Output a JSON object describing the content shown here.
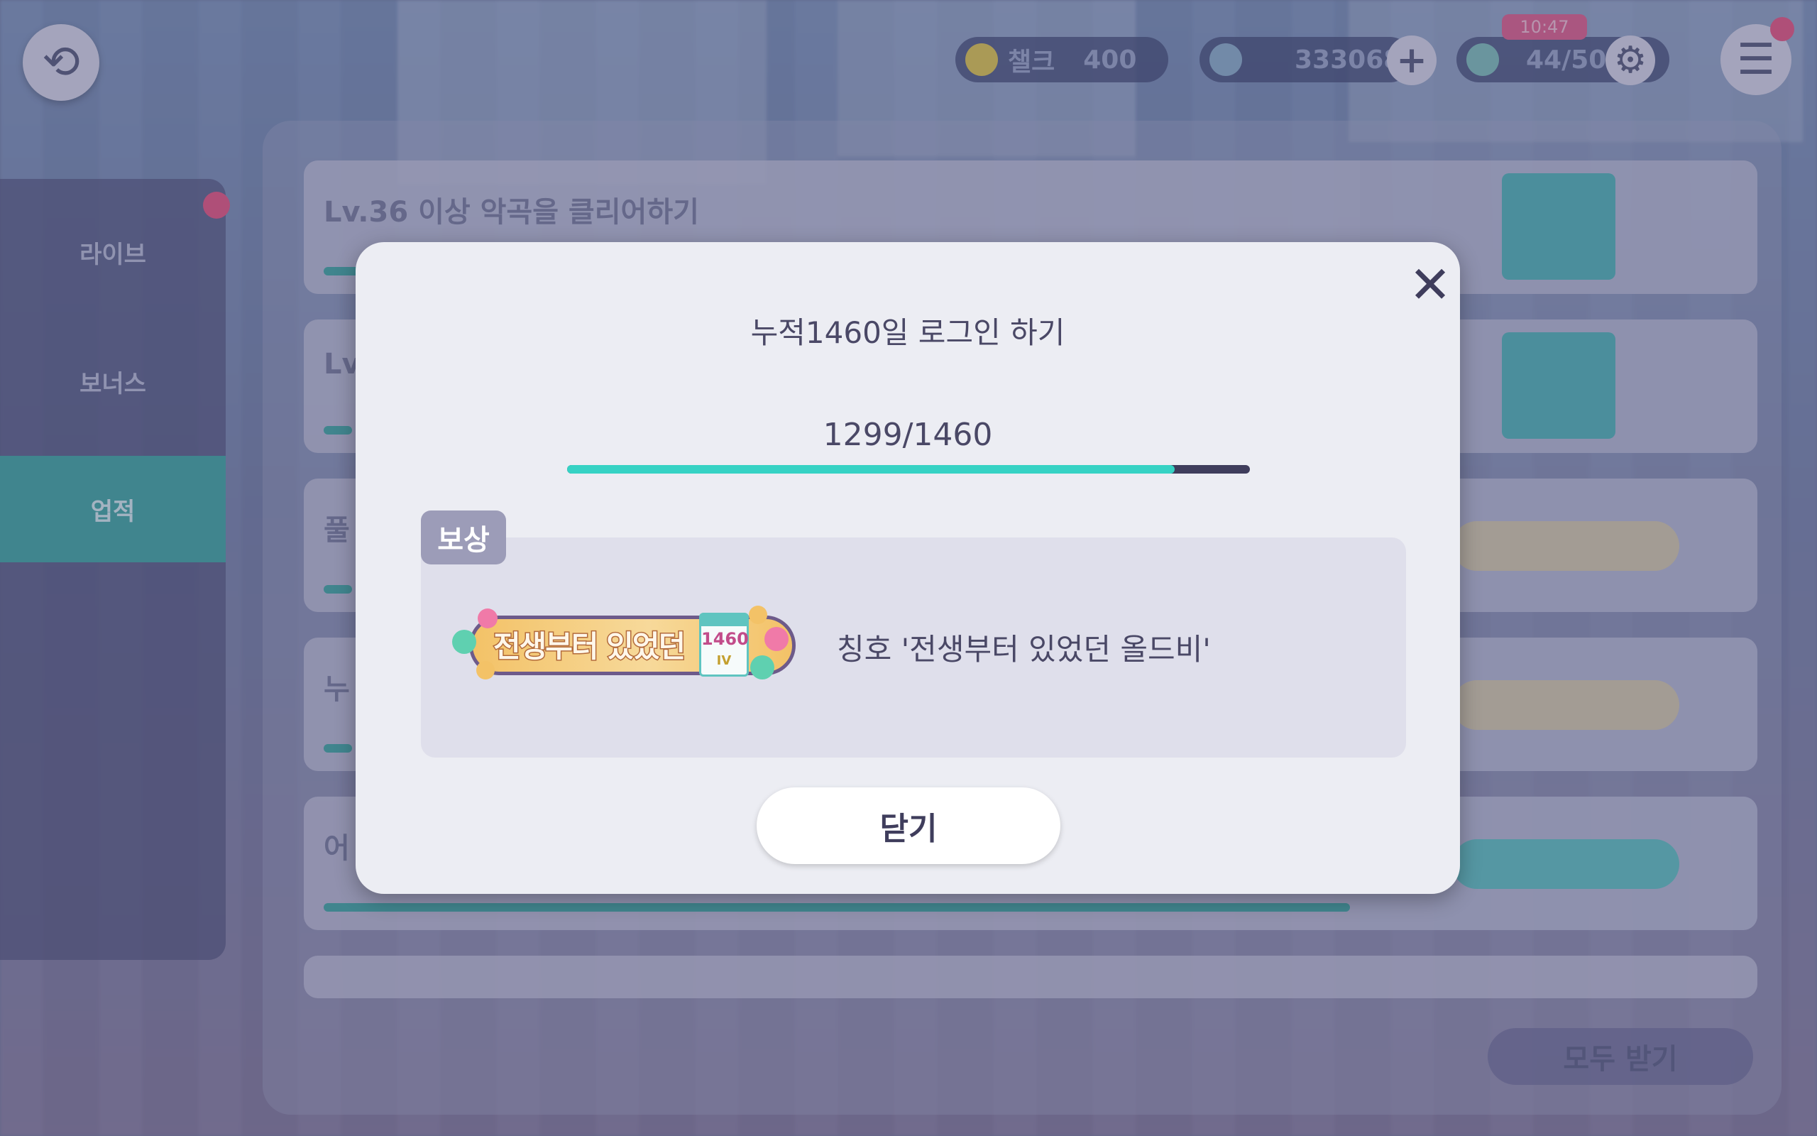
{
  "background": {
    "currency": {
      "stamina_label": "챌크",
      "stamina_value": "400",
      "crystal_value": "333068",
      "ticket_value": "44/50",
      "ticket_tag": "10:47"
    },
    "sidebar": {
      "items": [
        {
          "label": "라이브"
        },
        {
          "label": "보너스"
        },
        {
          "label": "업적"
        }
      ]
    },
    "missions": [
      {
        "text": "Lv.36 이상 악곡을 클리어하기",
        "progress": 0.03
      },
      {
        "text": "Lv",
        "progress": 0.02
      },
      {
        "text": "풀",
        "progress": 0.02
      },
      {
        "text": "누",
        "progress": 0.02
      },
      {
        "text": "어",
        "progress": 1.0
      }
    ],
    "claim_all_label": "모두 받기"
  },
  "modal": {
    "title": "누적1460일 로그인 하기",
    "progress_text": "1299/1460",
    "progress_current": 1299,
    "progress_total": 1460,
    "reward_tag": "보상",
    "badge": {
      "text": "전생부터 있었던",
      "calendar_number": "1460",
      "calendar_sub": "IV"
    },
    "reward_name": "칭호 '전생부터 있었던 올드비'",
    "close_button_label": "닫기",
    "colors": {
      "progress_fill": "#36d2c4",
      "progress_track": "#3f3d5c",
      "text": "#4a4866"
    }
  }
}
